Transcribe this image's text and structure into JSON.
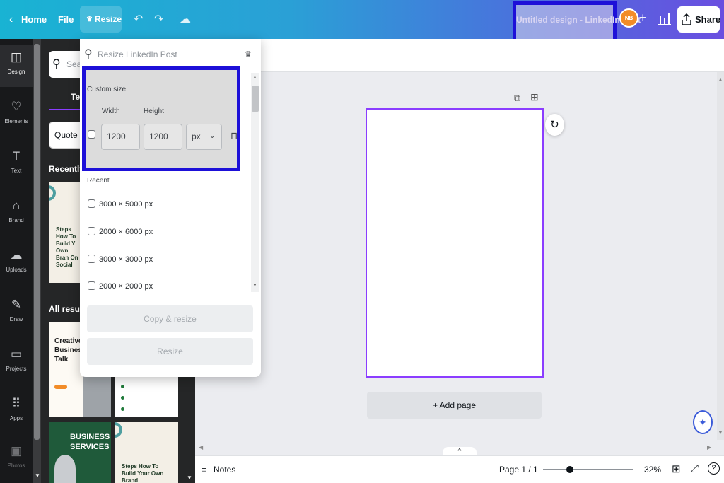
{
  "topbar": {
    "home_label": "Home",
    "file_label": "File",
    "resize_label": "Resize",
    "title": "Untitled design - LinkedIn Post",
    "avatar_initials": "NB",
    "share_label": "Share",
    "back_icon": "chevron-left-icon",
    "undo_icon": "undo-icon",
    "redo_icon": "redo-icon",
    "save_icon": "cloud-check-icon",
    "add_icon": "plus-icon",
    "insights_icon": "bar-chart-icon",
    "share_icon": "upload-icon",
    "accent_color": "#1d10d8"
  },
  "rail": {
    "items": [
      {
        "label": "Design",
        "icon": "design-icon"
      },
      {
        "label": "Elements",
        "icon": "elements-icon"
      },
      {
        "label": "Text",
        "icon": "text-icon"
      },
      {
        "label": "Brand",
        "icon": "brand-icon"
      },
      {
        "label": "Uploads",
        "icon": "uploads-icon"
      },
      {
        "label": "Draw",
        "icon": "draw-icon"
      },
      {
        "label": "Projects",
        "icon": "projects-icon"
      },
      {
        "label": "Apps",
        "icon": "apps-icon"
      },
      {
        "label": "Photos",
        "icon": "photos-icon"
      }
    ]
  },
  "panel": {
    "search_placeholder": "Sear",
    "tab_label": "Te",
    "chip_label": "Quote",
    "recently_used_heading": "Recently u",
    "all_results_heading": "All results",
    "thumbs": [
      {
        "text": "Steps How To Build Y Own Bran On Social"
      },
      {
        "text": "Creative Business Talk"
      },
      {
        "text": "BUSINESS SERVICES"
      },
      {
        "text": "Steps How To Build Your Own Brand"
      }
    ]
  },
  "popover": {
    "search_placeholder": "Resize LinkedIn Post",
    "custom_size_label": "Custom size",
    "width_label": "Width",
    "height_label": "Height",
    "width_value": "1200",
    "height_value": "1200",
    "unit_value": "px",
    "recent_label": "Recent",
    "recent_items": [
      "3000 × 5000 px",
      "2000 × 6000 px",
      "3000 × 3000 px",
      "2000 × 2000 px"
    ],
    "copy_resize_label": "Copy & resize",
    "resize_label": "Resize"
  },
  "canvas": {
    "add_page_label": "+ Add page"
  },
  "bottombar": {
    "notes_label": "Notes",
    "page_indicator": "Page 1 / 1",
    "zoom_label": "32%",
    "zoom_level_fraction": 0.32
  }
}
